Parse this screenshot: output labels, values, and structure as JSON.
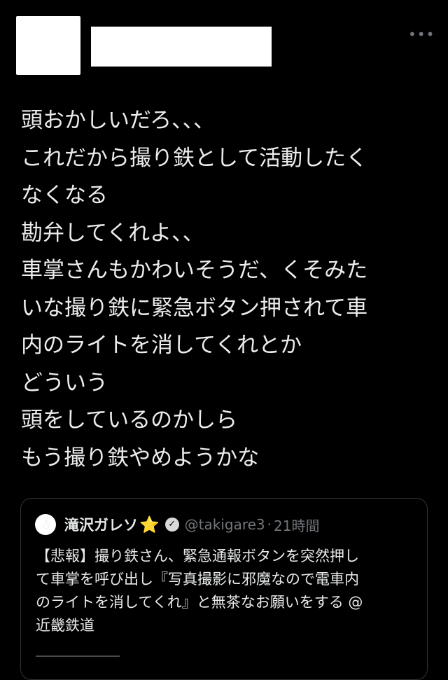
{
  "tweet": {
    "more_icon": "ellipsis-icon",
    "lines": [
      "頭おかしいだろ、、、",
      "これだから撮り鉄として活動したく",
      "なくなる",
      "勘弁してくれよ、、",
      "車掌さんもかわいそうだ、くそみた",
      "いな撮り鉄に緊急ボタン押されて車",
      "内のライトを消してくれとか",
      "どういう",
      "頭をしているのかしら",
      "もう撮り鉄やめようかな"
    ]
  },
  "quote": {
    "name": "滝沢ガレソ",
    "star": "⭐",
    "verified_icon": "verified-badge-icon",
    "handle": "@takigare3",
    "separator": "·",
    "time": "21時間",
    "lines": [
      "【悲報】撮り鉄さん、緊急通報ボタンを突然押し",
      "て車掌を呼び出し『写真撮影に邪魔なので電車内",
      "のライトを消してくれ』と無茶なお願いをする @",
      "近畿鉄道"
    ]
  },
  "colors": {
    "background": "#000000",
    "text": "#e7e9ea",
    "muted": "#71767b",
    "border": "#2f3336"
  }
}
